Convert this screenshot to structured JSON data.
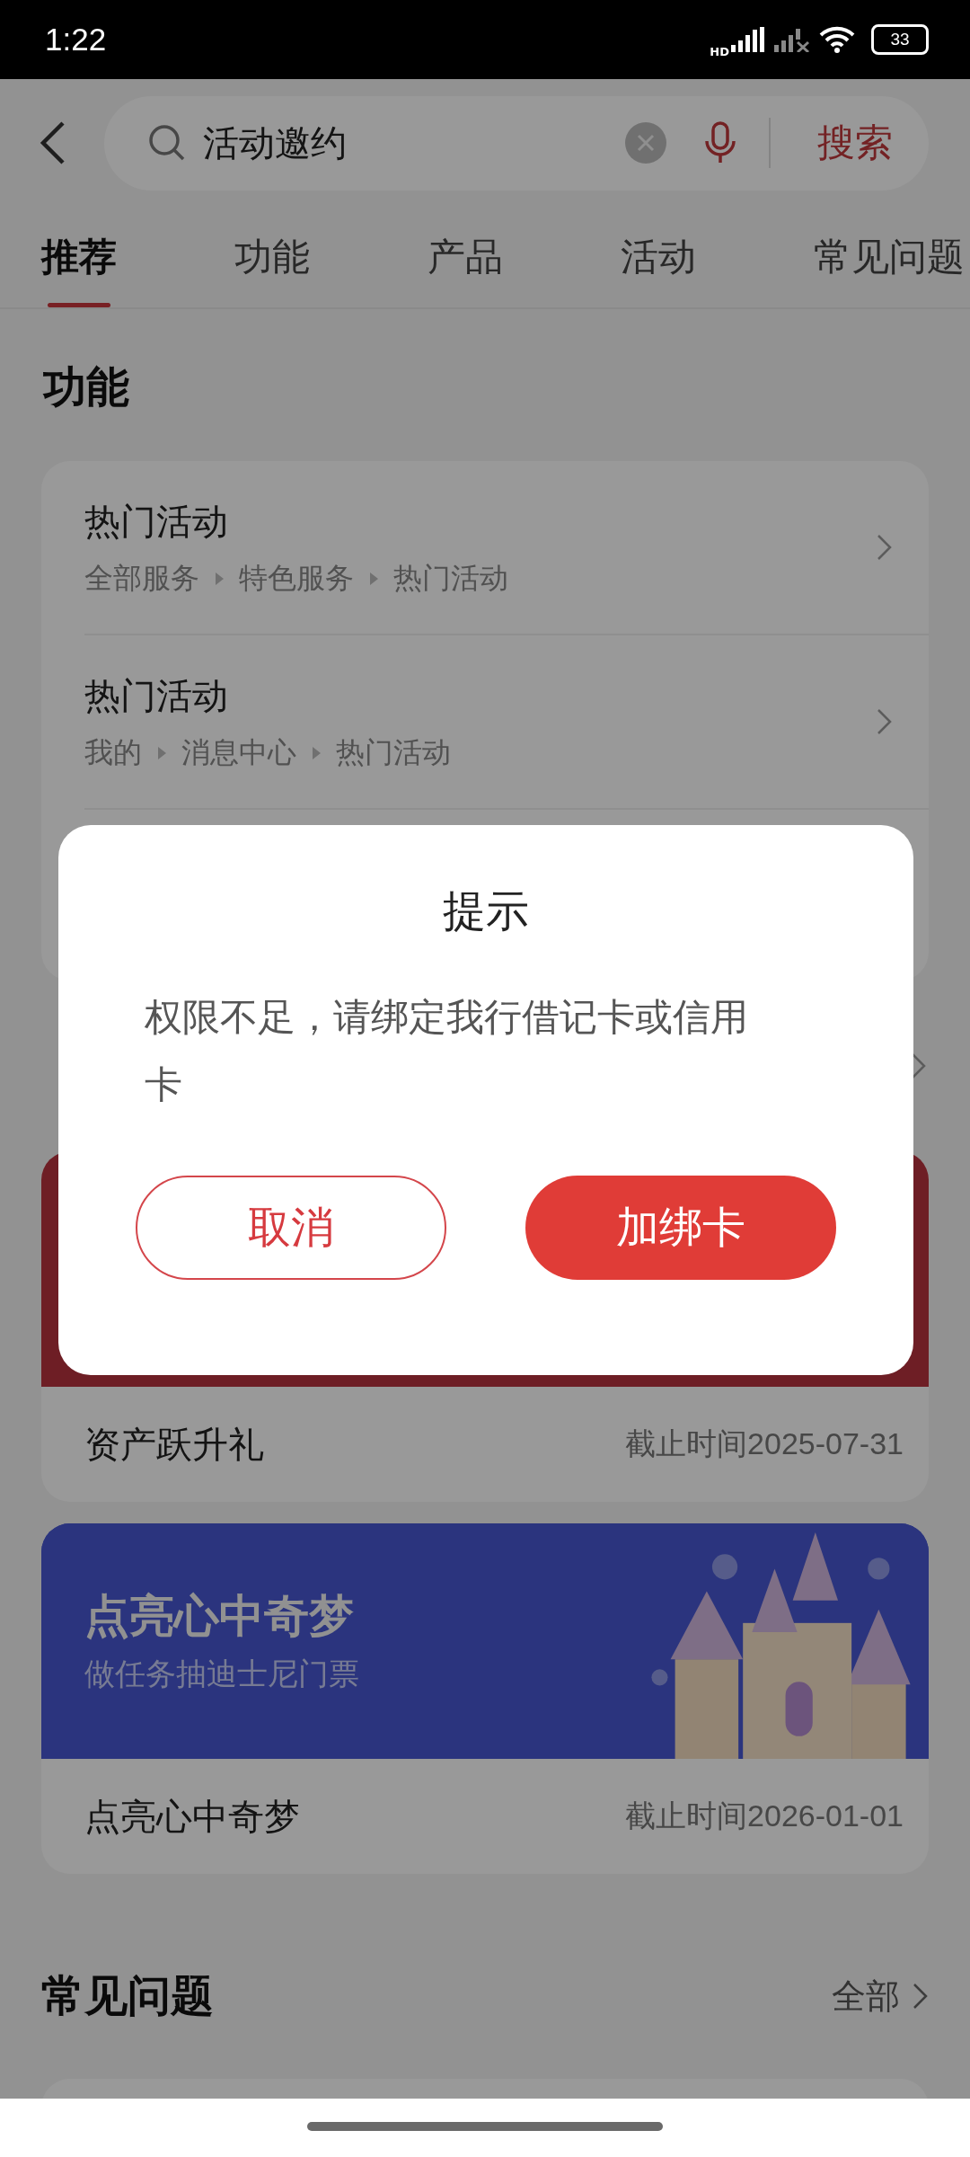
{
  "status_bar": {
    "time": "1:22",
    "signal_label": "HD",
    "battery": "33"
  },
  "search": {
    "value": "活动邀约",
    "button": "搜索"
  },
  "tabs": [
    {
      "label": "推荐",
      "selected": true
    },
    {
      "label": "功能",
      "selected": false
    },
    {
      "label": "产品",
      "selected": false
    },
    {
      "label": "活动",
      "selected": false
    },
    {
      "label": "常见问题",
      "selected": false
    }
  ],
  "functions": {
    "title": "功能",
    "items": [
      {
        "title": "热门活动",
        "path": [
          "全部服务",
          "特色服务",
          "热门活动"
        ]
      },
      {
        "title": "热门活动",
        "path": [
          "我的",
          "消息中心",
          "热门活动"
        ]
      }
    ]
  },
  "activities": [
    {
      "title": "资产跃升礼",
      "deadline": "截止时间2025-07-31",
      "banner": {
        "kind": "plain"
      }
    },
    {
      "title": "点亮心中奇梦",
      "deadline": "截止时间2026-01-01",
      "banner": {
        "kind": "picture",
        "headline": "点亮心中奇梦",
        "subtitle": "做任务抽迪士尼门票"
      }
    }
  ],
  "faq": {
    "title": "常见问题",
    "more": "全部"
  },
  "dialog": {
    "title": "提示",
    "message": "权限不足，请绑定我行借记卡或信用卡",
    "buttons": [
      {
        "label": "取消",
        "kind": "secondary"
      },
      {
        "label": "加绑卡",
        "kind": "primary"
      }
    ]
  }
}
